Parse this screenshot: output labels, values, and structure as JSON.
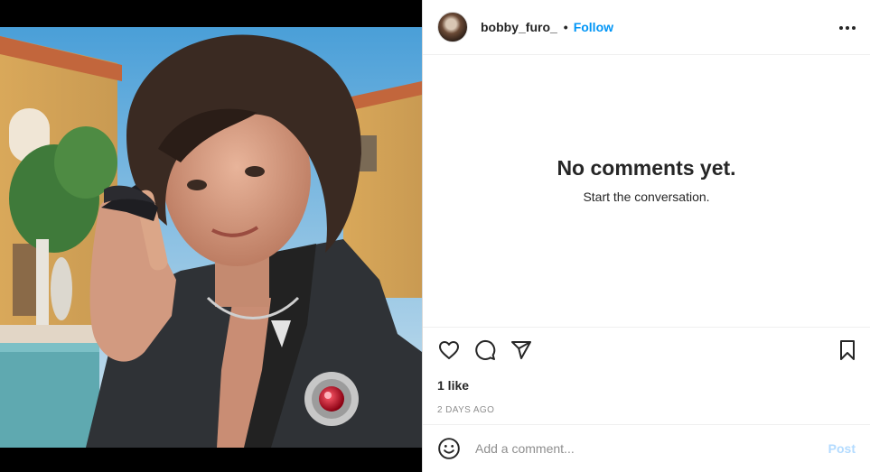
{
  "header": {
    "username": "bobby_furo_",
    "separator": "•",
    "follow_label": "Follow",
    "more_icon": "more-horizontal-icon"
  },
  "comments": {
    "empty_title": "No comments yet.",
    "empty_subtitle": "Start the conversation."
  },
  "actions": {
    "icons": [
      "heart-icon",
      "comment-icon",
      "share-icon",
      "bookmark-icon"
    ]
  },
  "stats": {
    "likes": "1 like",
    "posted": "2 DAYS AGO"
  },
  "add_comment": {
    "emoji_icon": "emoji-icon",
    "placeholder": "Add a comment...",
    "post_label": "Post"
  },
  "colors": {
    "accent": "#0095f6",
    "post_disabled": "#b3dbff",
    "text": "#262626",
    "muted": "#8e8e8e"
  }
}
